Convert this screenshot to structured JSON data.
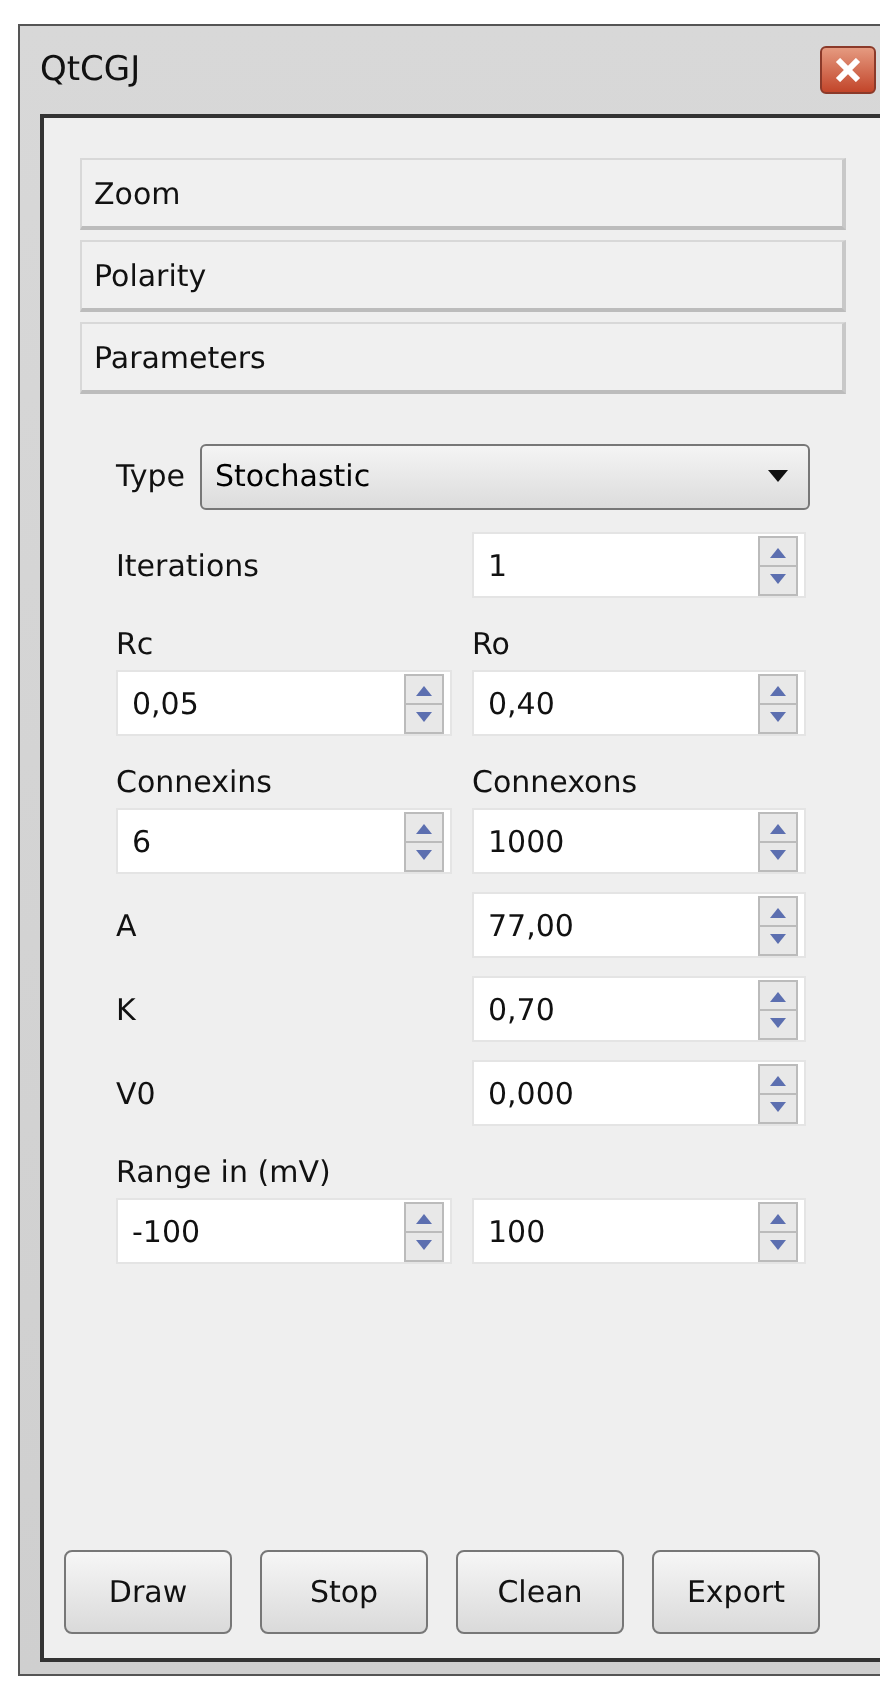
{
  "window": {
    "title": "QtCGJ"
  },
  "sections": [
    {
      "label": "Zoom"
    },
    {
      "label": "Polarity"
    },
    {
      "label": "Parameters"
    }
  ],
  "form": [
    {
      "kind": "combo",
      "label": "Type",
      "value": "Stochastic"
    },
    {
      "kind": "single",
      "label": "Iterations",
      "value": "1"
    },
    {
      "kind": "labels",
      "labels": [
        "Rc",
        "Ro"
      ]
    },
    {
      "kind": "spins",
      "values": [
        "0,05",
        "0,40"
      ]
    },
    {
      "kind": "labels",
      "labels": [
        "Connexins",
        "Connexons"
      ]
    },
    {
      "kind": "spins",
      "values": [
        "6",
        "1000"
      ]
    },
    {
      "kind": "single",
      "label": "A",
      "value": "77,00"
    },
    {
      "kind": "single",
      "label": "K",
      "value": "0,70"
    },
    {
      "kind": "single",
      "label": "V0",
      "value": "0,000"
    },
    {
      "kind": "labels",
      "labels": [
        "Range in (mV)"
      ]
    },
    {
      "kind": "spins",
      "values": [
        "-100",
        "100"
      ]
    }
  ],
  "buttons": [
    "Draw",
    "Stop",
    "Clean",
    "Export"
  ]
}
